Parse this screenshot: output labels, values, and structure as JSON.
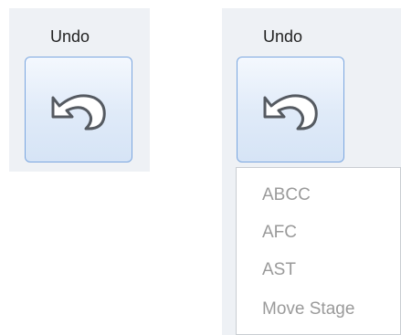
{
  "left_panel": {
    "title": "Undo",
    "button_icon": "undo-icon"
  },
  "right_panel": {
    "title": "Undo",
    "button_icon": "undo-icon",
    "dropdown": {
      "items": [
        "ABCC",
        "AFC",
        "AST",
        "Move Stage"
      ]
    }
  },
  "colors": {
    "panel_bg": "#eef1f5",
    "button_border": "#7ba7e0",
    "menu_text_disabled": "#9a9a9a"
  }
}
